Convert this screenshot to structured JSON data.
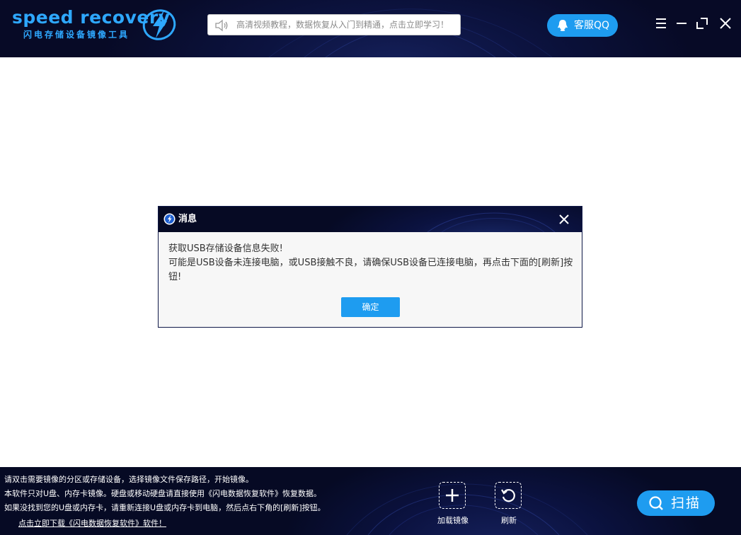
{
  "app": {
    "logo_text": "speed recovery",
    "logo_subtitle": "闪电存储设备镜像工具"
  },
  "header": {
    "notice_text": "高清视频教程，数据恢复从入门到精通，点击立即学习！",
    "qq_label": "客服QQ"
  },
  "dialog": {
    "title": "消息",
    "message_line1": "获取USB存储设备信息失败!",
    "message_line2": "可能是USB设备未连接电脑，或USB接触不良，请确保USB设备已连接电脑，再点击下面的[刷新]按钮!",
    "ok_label": "确定"
  },
  "footer": {
    "lines": [
      "请双击需要镜像的分区或存储设备，选择镜像文件保存路径，开始镜像。",
      "本软件只对U盘、内存卡镜像。硬盘或移动硬盘请直接使用《闪电数据恢复软件》恢复数据。",
      "如果没找到您的U盘或内存卡，请重新连接U盘或内存卡到电脑，然后点右下角的[刷新]按钮。"
    ],
    "download_link": "点击立即下载《闪电数据恢复软件》软件！",
    "load_image_label": "加载镜像",
    "refresh_label": "刷新",
    "scan_label": "扫描"
  },
  "colors": {
    "accent": "#1e9cf0",
    "logo": "#2ea8ff",
    "header_bg": "#070a26"
  },
  "icons": {
    "logo": "lightning-bolt-icon",
    "notice": "speaker-icon",
    "qq": "qq-penguin-icon",
    "menu": "hamburger-menu-icon",
    "minimize": "minimize-icon",
    "maximize": "maximize-icon",
    "close": "close-icon",
    "load": "plus-icon",
    "refresh": "refresh-icon",
    "scan": "search-icon"
  }
}
